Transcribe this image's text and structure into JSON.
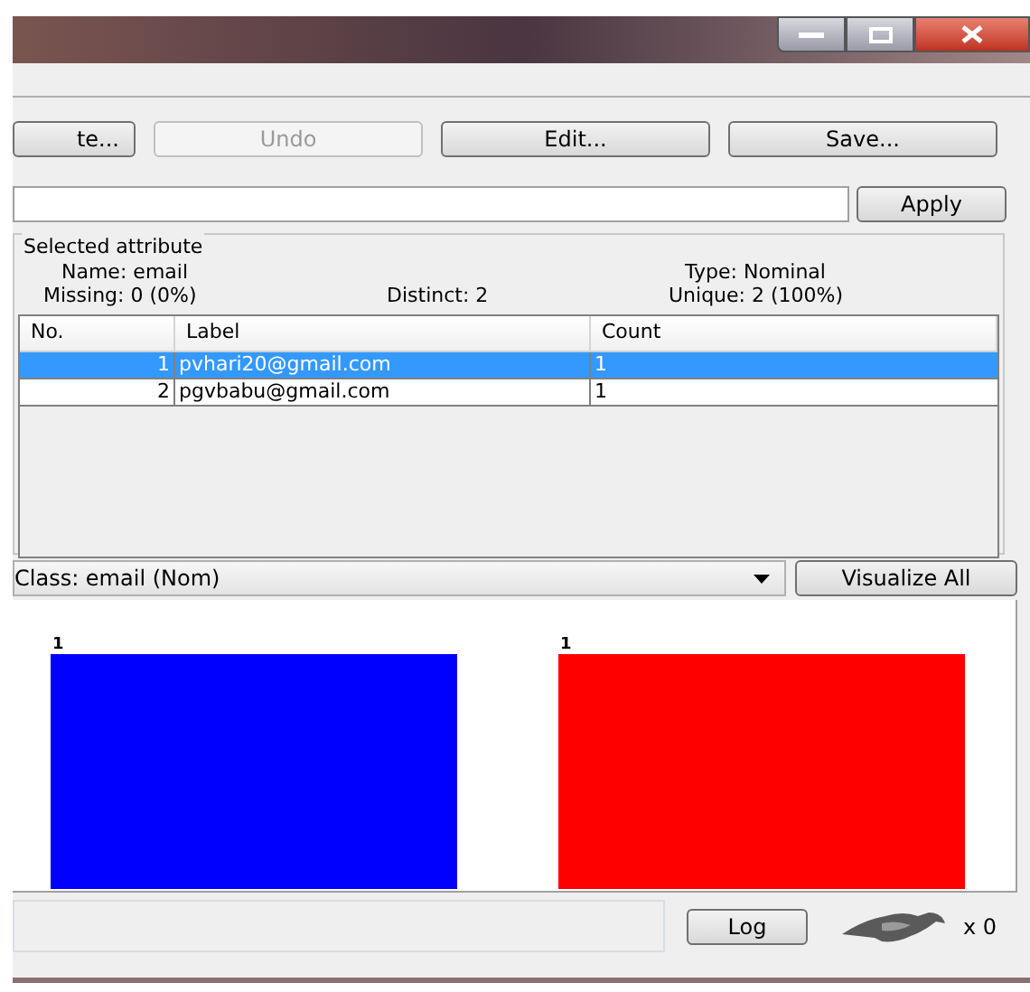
{
  "toolbar": {
    "buttons": [
      {
        "label": "te...",
        "disabled": false
      },
      {
        "label": "Undo",
        "disabled": true
      },
      {
        "label": "Edit...",
        "disabled": false
      },
      {
        "label": "Save...",
        "disabled": false
      }
    ]
  },
  "filter": {
    "apply": "Apply"
  },
  "selected_attribute": {
    "title": "Selected attribute",
    "name_label": "Name:",
    "name": "email",
    "type_label": "Type:",
    "type": "Nominal",
    "missing_label": "Missing:",
    "missing": "0 (0%)",
    "distinct_label": "Distinct:",
    "distinct": "2",
    "unique_label": "Unique:",
    "unique": "2 (100%)",
    "table": {
      "columns": [
        "No.",
        "Label",
        "Count"
      ],
      "rows": [
        {
          "no": "1",
          "label": "pvhari20@gmail.com",
          "count": "1",
          "selected": true
        },
        {
          "no": "2",
          "label": "pgvbabu@gmail.com",
          "count": "1",
          "selected": false
        }
      ]
    }
  },
  "class_select": {
    "value": "Class: email (Nom)",
    "visualize": "Visualize All"
  },
  "histogram": {
    "chart_data": {
      "type": "bar",
      "data_labels": true,
      "series": [
        {
          "color": "#0000ff",
          "values": [
            1
          ]
        },
        {
          "color": "#ff0000",
          "values": [
            1
          ]
        }
      ]
    }
  },
  "status_bar": {
    "log": "Log",
    "count": "x 0"
  }
}
